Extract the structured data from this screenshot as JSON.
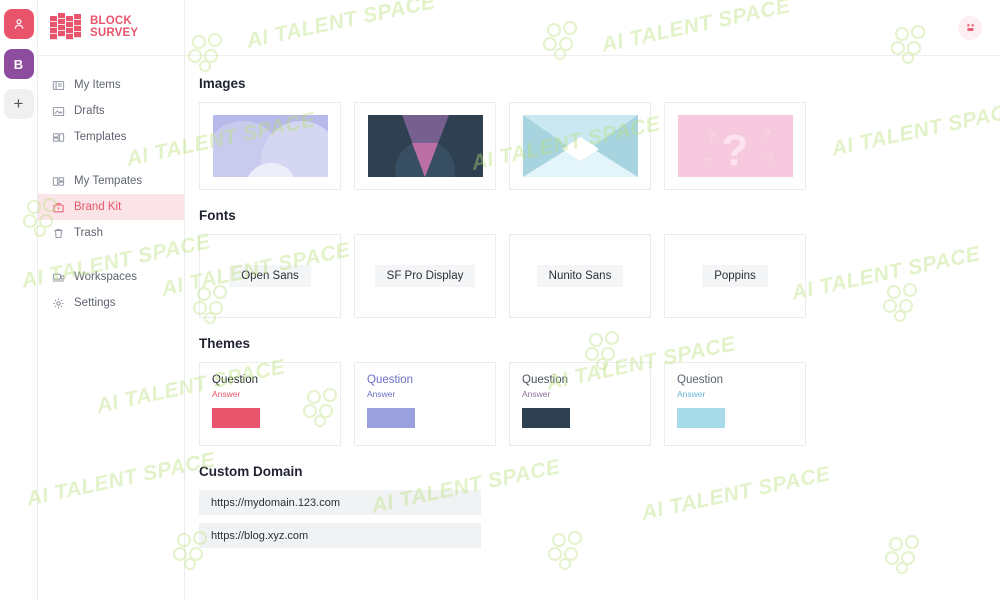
{
  "brand": {
    "name_line1": "BLOCK",
    "name_line2": "SURVEY",
    "accent": "#e8546b"
  },
  "rail": {
    "user_initial": "",
    "workspace_initial": "B",
    "add_label": "+"
  },
  "sidebar": {
    "items": [
      {
        "label": "My Items",
        "icon": "list-card-icon",
        "active": false
      },
      {
        "label": "Drafts",
        "icon": "draft-image-icon",
        "active": false
      },
      {
        "label": "Templates",
        "icon": "layout-icon",
        "active": false
      },
      {
        "label": "My Tempates",
        "icon": "grid-icon",
        "active": false
      },
      {
        "label": "Brand Kit",
        "icon": "toolbox-icon",
        "active": true
      },
      {
        "label": "Trash",
        "icon": "trash-icon",
        "active": false
      },
      {
        "label": "Workspaces",
        "icon": "workspace-icon",
        "active": false
      },
      {
        "label": "Settings",
        "icon": "gear-icon",
        "active": false
      }
    ]
  },
  "topbar": {
    "avatar_icon": "face-avatar-icon"
  },
  "sections": {
    "images": {
      "title": "Images",
      "items": [
        {
          "name": "image-1",
          "bg": "#b7b9e8",
          "style": "circles-light"
        },
        {
          "name": "image-2",
          "bg": "#2f4050",
          "style": "triangle-purple"
        },
        {
          "name": "image-3",
          "bg": "#a8d4e0",
          "style": "envelope-blue"
        },
        {
          "name": "image-4",
          "bg": "#f7c9de",
          "style": "question-pink"
        }
      ]
    },
    "fonts": {
      "title": "Fonts",
      "items": [
        "Open Sans",
        "SF Pro Display",
        "Nunito Sans",
        "Poppins"
      ]
    },
    "themes": {
      "title": "Themes",
      "question_label": "Question",
      "answer_label": "Answer",
      "items": [
        {
          "question_color": "#252a33",
          "answer_color": "#e8546b",
          "swatch": "#e8546b"
        },
        {
          "question_color": "#6b70c4",
          "answer_color": "#6b70c4",
          "swatch": "#9aa0dd"
        },
        {
          "question_color": "#4a5160",
          "answer_color": "#8f6f9a",
          "swatch": "#2f4050"
        },
        {
          "question_color": "#5c6370",
          "answer_color": "#68b3d6",
          "swatch": "#a8dbea"
        }
      ]
    },
    "custom_domain": {
      "title": "Custom Domain",
      "values": [
        "https://mydomain.123.com",
        "https://blog.xyz.com"
      ]
    }
  },
  "watermark": {
    "text": "AI TALENT SPACE",
    "color": "#b9e07a"
  }
}
